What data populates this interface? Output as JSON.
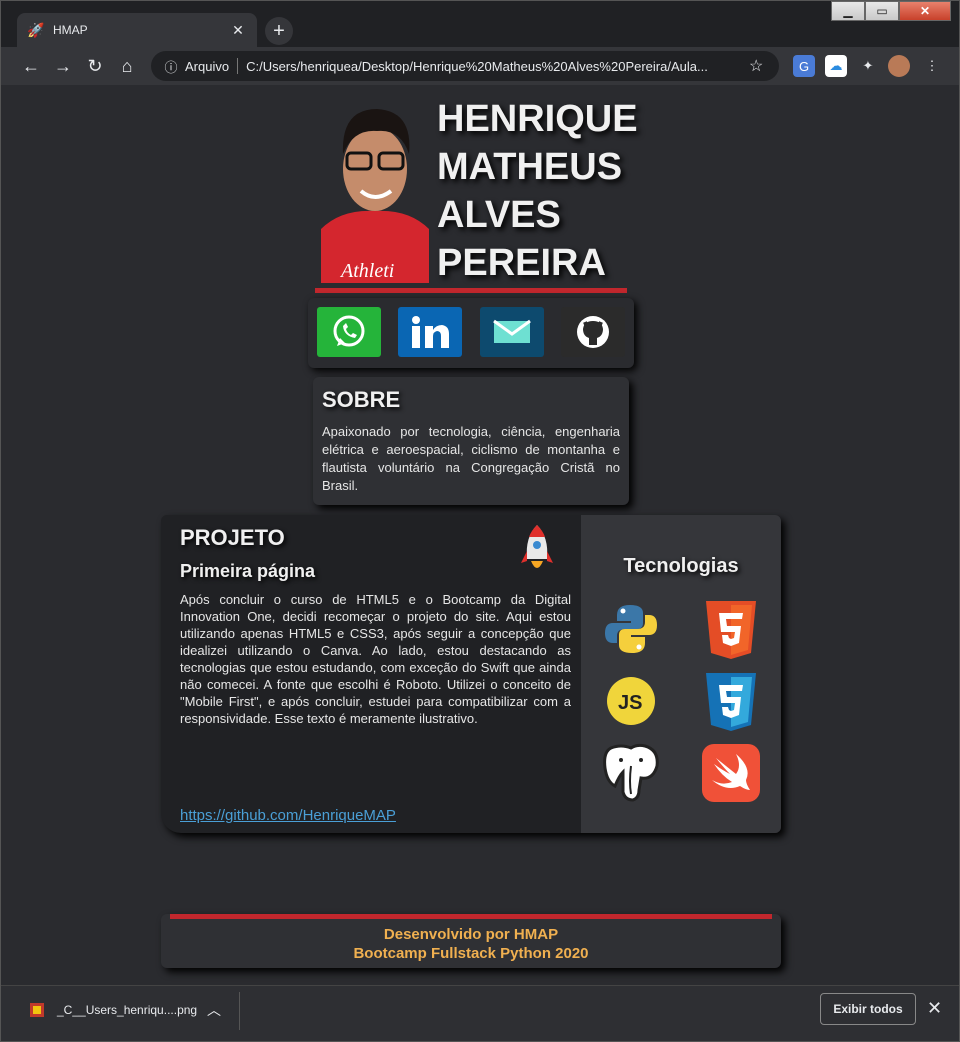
{
  "browser": {
    "tab_title": "HMAP",
    "tab_close": "✕",
    "new_tab": "+",
    "omnibox_scheme": "Arquivo",
    "url": "C:/Users/henriquea/Desktop/Henrique%20Matheus%20Alves%20Pereira/Aula..."
  },
  "header": {
    "name_lines": [
      "HENRIQUE",
      "MATHEUS",
      "ALVES",
      "PEREIRA"
    ]
  },
  "social": {
    "items": [
      "whatsapp-icon",
      "linkedin-icon",
      "email-icon",
      "github-icon"
    ],
    "colors": {
      "whatsapp": "#25b43a",
      "linkedin": "#0a66b3",
      "email": "#0d4a6e",
      "github": "#2b2b2b"
    }
  },
  "sobre": {
    "title": "SOBRE",
    "text": "Apaixonado por tecnologia, ciência, engenharia elétrica e aeroespacial, ciclismo de montanha e flautista voluntário na Congregação Cristã no Brasil."
  },
  "projeto": {
    "title": "PROJETO",
    "subtitle": "Primeira página",
    "text": "Após concluir o curso de HTML5 e o Bootcamp da Digital Innovation One, decidi recomeçar o projeto do site. Aqui estou utilizando apenas HTML5 e CSS3, após seguir a concepção que idealizei utilizando o Canva. Ao lado, estou destacando as tecnologias que estou estudando, com exceção do Swift que ainda não comecei. A fonte que escolhi é Roboto. Utilizei o conceito de \"Mobile First\", e após concluir, estudei para compatibilizar com a responsividade. Esse texto é meramente ilustrativo.",
    "link": "https://github.com/HenriqueMAP"
  },
  "tecnologias": {
    "title": "Tecnologias",
    "items": [
      "python-icon",
      "html5-icon",
      "javascript-icon",
      "css3-icon",
      "postgresql-icon",
      "swift-icon"
    ],
    "js_label": "JS"
  },
  "footer": {
    "line1": "Desenvolvido por HMAP",
    "line2": "Bootcamp Fullstack Python 2020"
  },
  "downloads": {
    "file_name": "_C__Users_henriqu....png",
    "show_all": "Exibir todos"
  },
  "colors": {
    "accent_red": "#c1272d",
    "footer_text": "#f0b050",
    "link": "#4a9fd6"
  }
}
